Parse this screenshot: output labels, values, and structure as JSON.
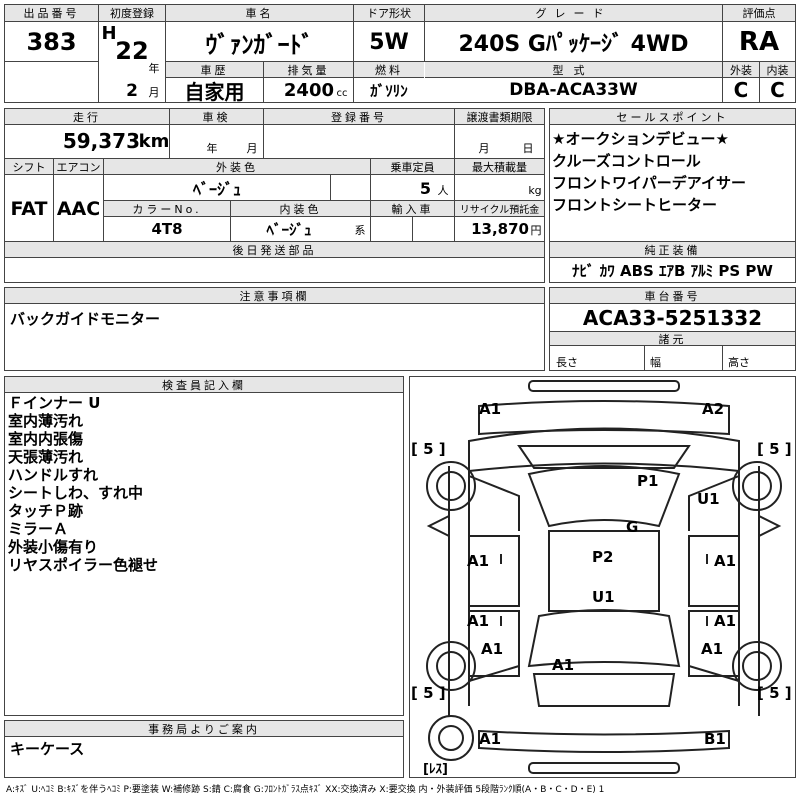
{
  "header": {
    "lot_no_label": "出品番号",
    "lot_no": "383",
    "first_reg_label": "初度登録",
    "era": "H",
    "year": "22",
    "year_unit": "年",
    "month": "2",
    "month_unit": "月",
    "car_name_label": "車名",
    "car_name": "ｳﾞｧﾝｶﾞｰﾄﾞ",
    "door_label": "ドア形状",
    "door": "5W",
    "grade_label": "グレード",
    "grade": "240S Gﾊﾟｯｹｰｼﾞ 4WD",
    "score_label": "評価点",
    "score": "RA",
    "history_label": "車歴",
    "history": "自家用",
    "displacement_label": "排気量",
    "displacement": "2400",
    "displacement_unit": "cc",
    "fuel_label": "燃料",
    "fuel": "ｶﾞｿﾘﾝ",
    "model_label": "型式",
    "model": "DBA-ACA33W",
    "ext_label": "外装",
    "ext_grade": "C",
    "int_label": "内装",
    "int_grade": "C"
  },
  "row2": {
    "mileage_label": "走行",
    "mileage": "59,373",
    "mileage_unit": "km",
    "inspection_label": "車検",
    "year_unit": "年",
    "month_unit": "月",
    "reg_no_label": "登録番号",
    "transfer_label": "譲渡書類期限",
    "day_unit": "日",
    "shift_label": "シフト",
    "shift": "FAT",
    "ac_label": "エアコン",
    "ac": "AAC",
    "exterior_color_label": "外装色",
    "exterior_color": "ﾍﾞｰｼﾞｭ",
    "seats_label": "乗車定員",
    "seats": "5",
    "seats_unit": "人",
    "max_load_label": "最大積載量",
    "max_load_unit": "kg",
    "color_no_label": "カラーNo.",
    "color_no": "4T8",
    "interior_color_label": "内装色",
    "interior_color": "ﾍﾞｰｼﾞｭ",
    "interior_suffix": "系",
    "import_label": "輸入車",
    "recycle_label": "リサイクル預託金",
    "recycle": "13,870",
    "recycle_unit": "円",
    "later_parts_label": "後日発送部品"
  },
  "sales_points": {
    "label": "セールスポイント",
    "items": [
      "★オークションデビュー★",
      "クルーズコントロール",
      "フロントワイパーデアイサー",
      "フロントシートヒーター"
    ]
  },
  "equipment": {
    "label": "純正装備",
    "text": "ﾅﾋﾞ ｶﾜ ABS ｴｱB ｱﾙﾐ PS PW"
  },
  "caution": {
    "label": "注意事項欄",
    "text": "バックガイドモニター"
  },
  "chassis": {
    "label": "車台番号",
    "number": "ACA33-5251332",
    "specs_label": "諸元",
    "length_label": "長さ",
    "width_label": "幅",
    "height_label": "高さ"
  },
  "inspector": {
    "label": "検査員記入欄",
    "lines": [
      "Ｆインナー U",
      "室内薄汚れ",
      "室内内張傷",
      "天張薄汚れ",
      "ハンドルすれ",
      "シートしわ、すれ中",
      "タッチＰ跡",
      "ミラーＡ",
      "外装小傷有り",
      "リヤスポイラー色褪せ"
    ]
  },
  "office": {
    "label": "事務局よりご案内",
    "text": "キーケース"
  },
  "diagram": {
    "marks": [
      "A1",
      "A2",
      "P1",
      "U1",
      "G",
      "P2",
      "U1",
      "A1",
      "A1",
      "A1",
      "A1",
      "A1",
      "A1",
      "A1",
      "A1",
      "B1"
    ],
    "tires": [
      "[ 5 ]",
      "[ 5 ]",
      "[ 5 ]",
      "[ 5 ]"
    ],
    "spare": "[ﾚｽ]"
  },
  "legend": "A:ｷｽﾞ U:ﾍｺﾐ B:ｷｽﾞを伴うﾍｺﾐ P:要塗装 W:補修跡 S:錆 C:腐食 G:ﾌﾛﾝﾄｶﾞﾗｽ点ｷｽﾞ XX:交換済み X:要交換 内・外装評価 5段階ﾗﾝｸ順(A・B・C・D・E) 1"
}
